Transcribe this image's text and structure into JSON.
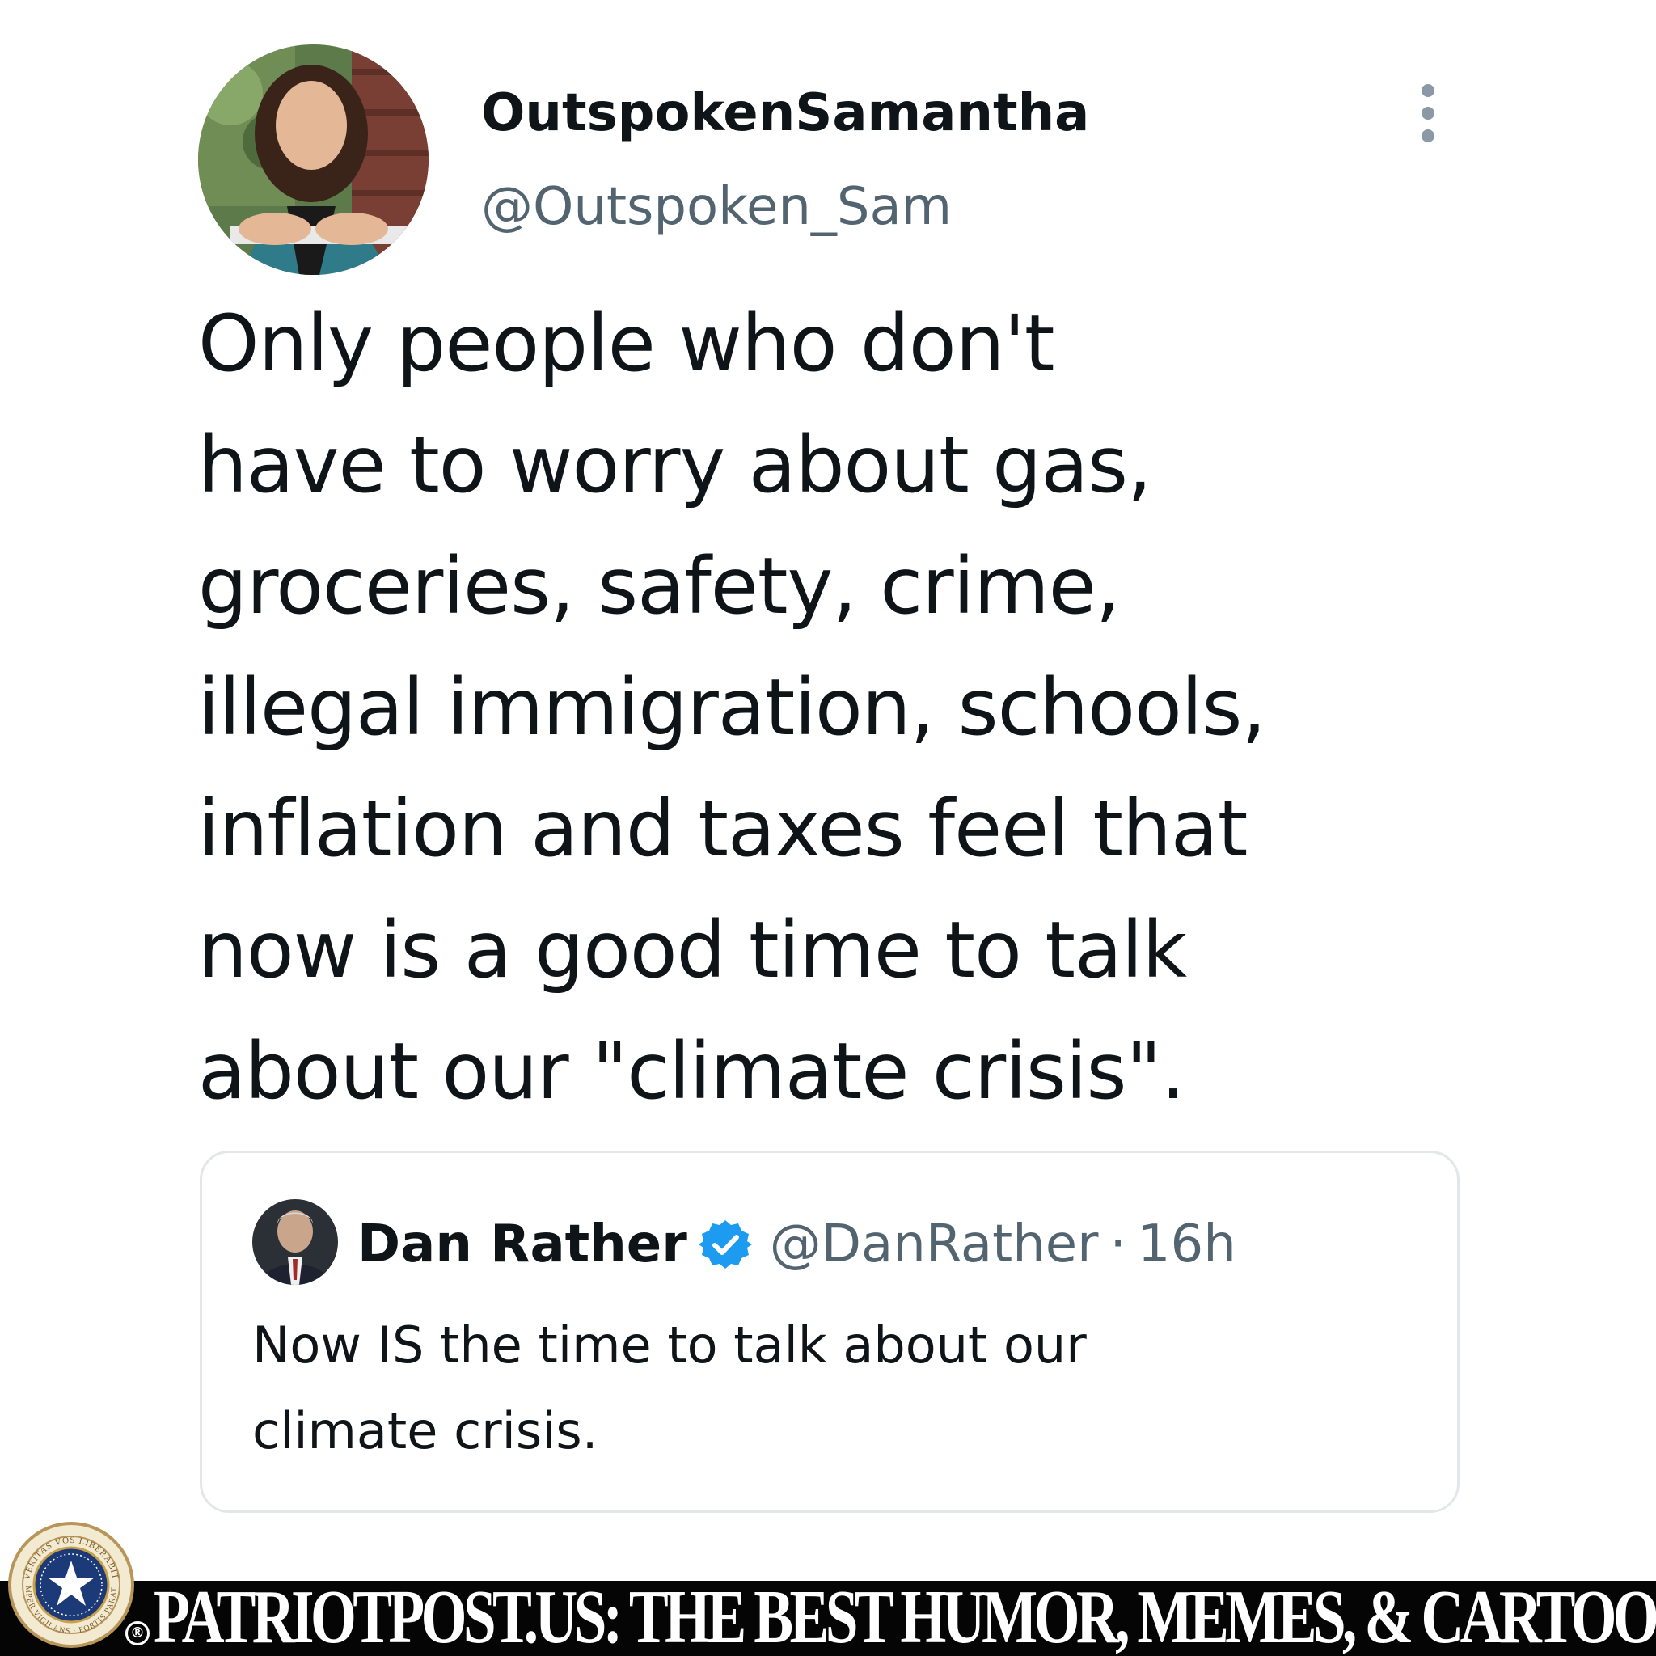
{
  "tweet": {
    "author": {
      "display_name": "OutspokenSamantha",
      "handle": "@Outspoken_Sam"
    },
    "more_icon": "more-vertical-icon",
    "text_lines": [
      "Only people who don't",
      "have to worry about gas,",
      "groceries, safety, crime,",
      "illegal immigration, schools,",
      "inflation and taxes feel that",
      "now is a good time to talk",
      "about our \"climate crisis\"."
    ]
  },
  "quoted_tweet": {
    "display_name": "Dan Rather",
    "verified_icon": "verified-badge-icon",
    "handle": "@DanRather",
    "separator": "·",
    "time": "16h",
    "text_lines": [
      "Now IS the time to talk about our",
      "climate crisis."
    ]
  },
  "footer": {
    "seal_logo": "patriot-post-seal-logo",
    "seal_text_top": "VERITAS VOS LIBERABIT",
    "seal_text_left": "SEMPER VIGILANS",
    "seal_text_bottom": "FORTIS PARATUS",
    "registered": "®",
    "banner_text": "PATRIOTPOST.US: THE BEST HUMOR, MEMES, & CARTOONS"
  },
  "colors": {
    "primary_text": "#0f1419",
    "secondary_text": "#536471",
    "verified_blue": "#1d9bf0",
    "card_border": "#e3e7ea",
    "banner_bg": "#050505",
    "banner_text": "#ffffff"
  }
}
